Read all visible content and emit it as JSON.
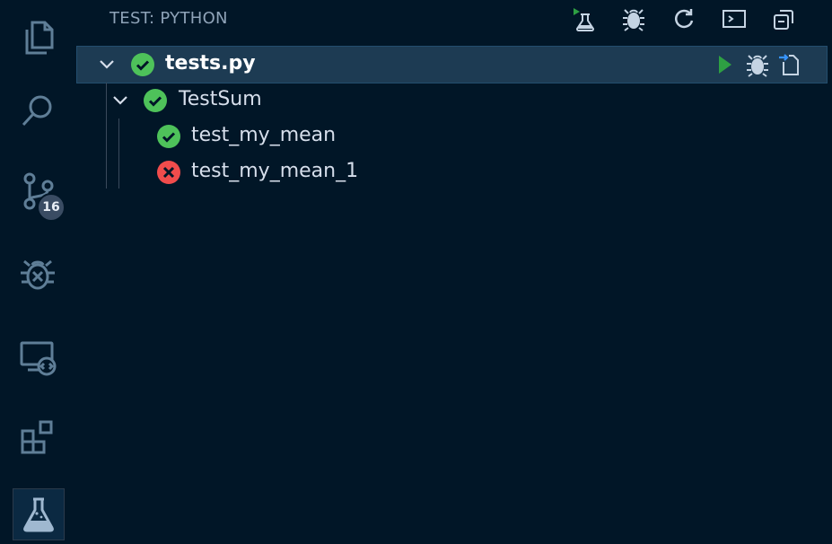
{
  "panel": {
    "title": "TEST: PYTHON"
  },
  "activity_bar": {
    "items": [
      {
        "icon": "explorer-icon"
      },
      {
        "icon": "search-icon"
      },
      {
        "icon": "source-control-icon",
        "badge": "16"
      },
      {
        "icon": "debug-icon"
      },
      {
        "icon": "remote-explorer-icon"
      },
      {
        "icon": "extensions-icon"
      },
      {
        "icon": "testing-flask-icon",
        "active": true
      }
    ]
  },
  "toolbar": {
    "icons": [
      "run-all-tests-icon",
      "debug-all-tests-icon",
      "refresh-icon",
      "show-output-icon",
      "collapse-all-icon"
    ]
  },
  "tree": {
    "file": {
      "label": "tests.py",
      "status": "passed"
    },
    "suite": {
      "label": "TestSum",
      "status": "passed"
    },
    "tests": [
      {
        "label": "test_my_mean",
        "status": "passed"
      },
      {
        "label": "test_my_mean_1",
        "status": "failed"
      }
    ]
  },
  "colors": {
    "background": "#011627",
    "selected_row": "#1d3b53",
    "pass": "#4ec25a",
    "fail": "#f14c4c",
    "run": "#2ea043"
  }
}
